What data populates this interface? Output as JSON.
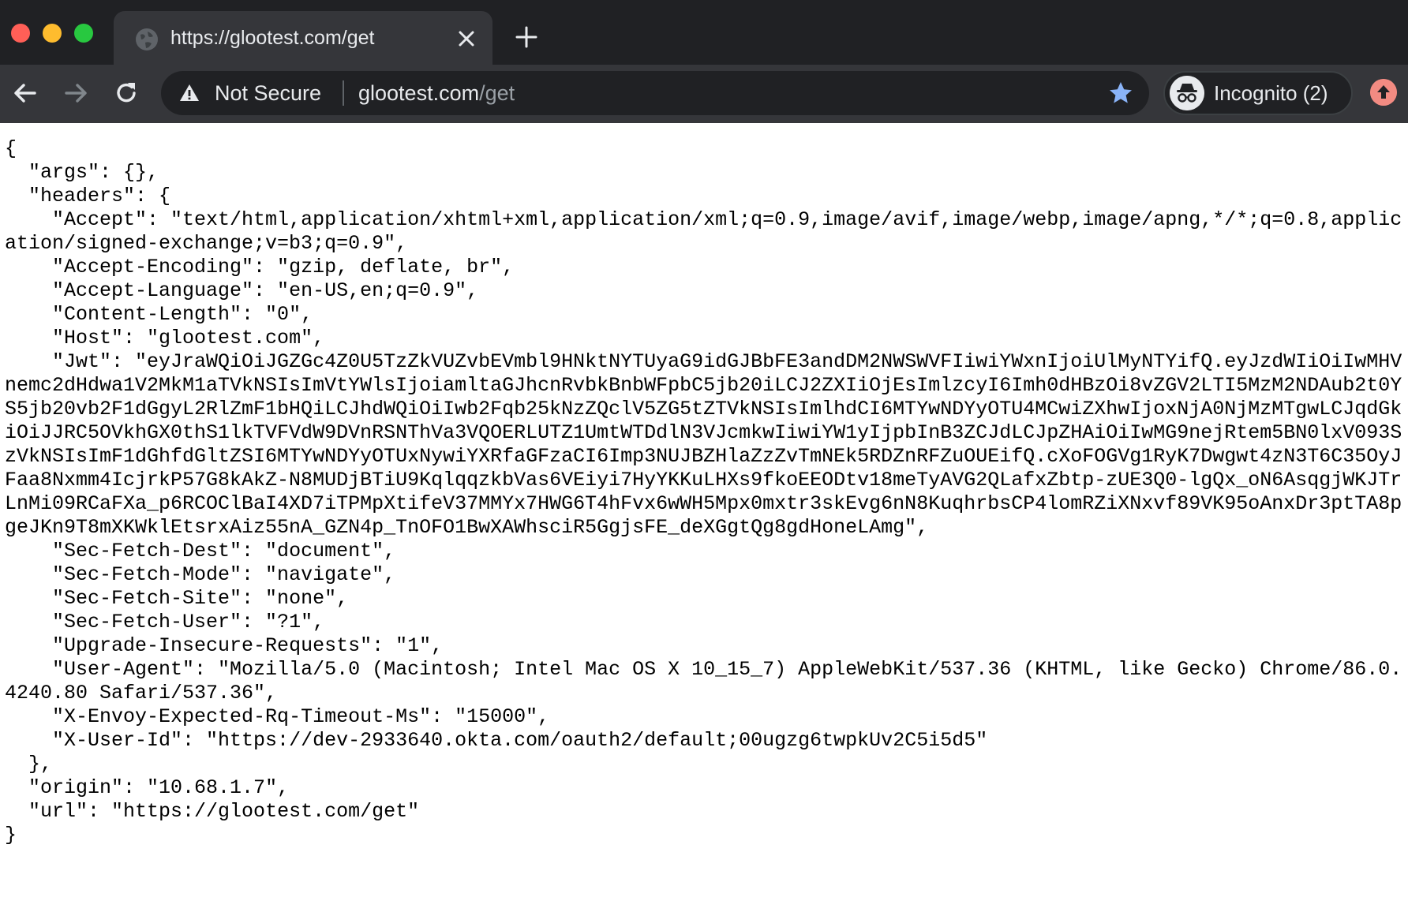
{
  "browser": {
    "tab": {
      "title": "https://glootest.com/get",
      "favicon": "globe-icon",
      "close_icon": "close-icon"
    },
    "new_tab_icon": "plus-icon",
    "nav": {
      "back_icon": "arrow-left-icon",
      "forward_icon": "arrow-right-icon",
      "reload_icon": "reload-icon"
    },
    "omnibox": {
      "security_icon": "warning-icon",
      "security_label": "Not Secure",
      "url_host": "glootest.com",
      "url_path": "/get",
      "bookmark_icon": "star-icon"
    },
    "profile": {
      "icon": "incognito-icon",
      "label": "Incognito (2)"
    },
    "update_icon": "update-arrow-icon",
    "colors": {
      "frame": "#202124",
      "toolbar": "#35363a",
      "text": "#e8eaed",
      "muted": "#9aa0a6",
      "star": "#8ab4f8",
      "update": "#f28b82"
    }
  },
  "page": {
    "json_text": "{\n  \"args\": {},\n  \"headers\": {\n    \"Accept\": \"text/html,application/xhtml+xml,application/xml;q=0.9,image/avif,image/webp,image/apng,*/*;q=0.8,application/signed-exchange;v=b3;q=0.9\",\n    \"Accept-Encoding\": \"gzip, deflate, br\",\n    \"Accept-Language\": \"en-US,en;q=0.9\",\n    \"Content-Length\": \"0\",\n    \"Host\": \"glootest.com\",\n    \"Jwt\": \"eyJraWQiOiJGZGc4Z0U5TzZkVUZvbEVmbl9HNktNYTUyaG9idGJBbFE3andDM2NWSWVFIiwiYWxnIjoiUlMyNTYifQ.eyJzdWIiOiIwMHVnemc2dHdwa1V2MkM1aTVkNSIsImVtYWlsIjoiamltaGJhcnRvbkBnbWFpbC5jb20iLCJ2ZXIiOjEsImlzcyI6Imh0dHBzOi8vZGV2LTI5MzM2NDAub2t0YS5jb20vb2F1dGgyL2RlZmF1bHQiLCJhdWQiOiIwb2Fqb25kNzZQclV5ZG5tZTVkNSIsImlhdCI6MTYwNDYyOTU4MCwiZXhwIjoxNjA0NjMzMTgwLCJqdGkiOiJJRC5OVkhGX0thS1lkTVFVdW9DVnRSNThVa3VQOERLUTZ1UmtWTDdlN3VJcmkwIiwiYW1yIjpbInB3ZCJdLCJpZHAiOiIwMG9nejRtem5BN0lxV093SzVkNSIsImF1dGhfdGltZSI6MTYwNDYyOTUxNywiYXRfaGFzaCI6Imp3NUJBZHlaZzZvTmNEk5RDZnRFZuOUEifQ.cXoFOGVg1RyK7Dwgwt4zN3T6C35OyJFaa8Nxmm4IcjrkP57G8kAkZ-N8MUDjBTiU9KqlqqzkbVas6VEiyi7HyYKKuLHXs9fkoEEODtv18meTyAVG2QLafxZbtp-zUE3Q0-lgQx_oN6AsqgjWKJTrLnMi09RCaFXa_p6RCOClBaI4XD7iTPMpXtifeV37MMYx7HWG6T4hFvx6wWH5Mpx0mxtr3skEvg6nN8KuqhrbsCP4lomRZiXNxvf89VK95oAnxDr3ptTA8pgeJKn9T8mXKWklEtsrxAiz55nA_GZN4p_TnOFO1BwXAWhsciR5GgjsFE_deXGgtQg8gdHoneLAmg\",\n    \"Sec-Fetch-Dest\": \"document\",\n    \"Sec-Fetch-Mode\": \"navigate\",\n    \"Sec-Fetch-Site\": \"none\",\n    \"Sec-Fetch-User\": \"?1\",\n    \"Upgrade-Insecure-Requests\": \"1\",\n    \"User-Agent\": \"Mozilla/5.0 (Macintosh; Intel Mac OS X 10_15_7) AppleWebKit/537.36 (KHTML, like Gecko) Chrome/86.0.4240.80 Safari/537.36\",\n    \"X-Envoy-Expected-Rq-Timeout-Ms\": \"15000\",\n    \"X-User-Id\": \"https://dev-2933640.okta.com/oauth2/default;00ugzg6twpkUv2C5i5d5\"\n  },\n  \"origin\": \"10.68.1.7\",\n  \"url\": \"https://glootest.com/get\"\n}"
  }
}
